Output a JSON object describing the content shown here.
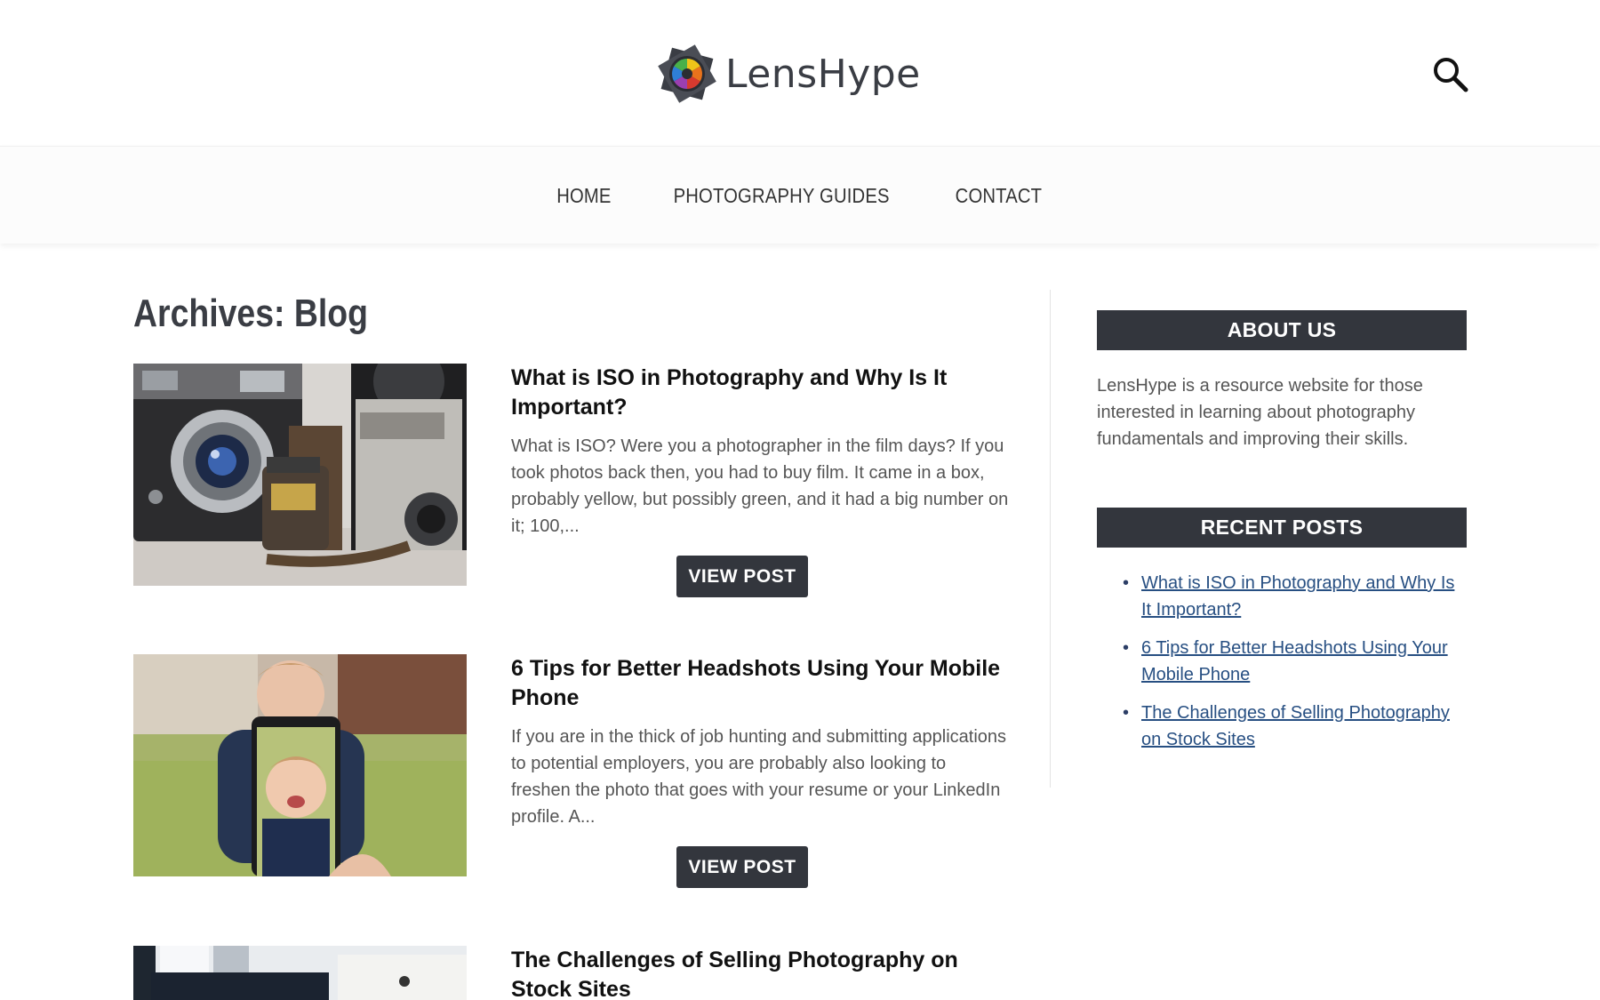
{
  "header": {
    "brand": "LensHype",
    "search_icon": "search-icon"
  },
  "nav": {
    "items": [
      {
        "label": "HOME"
      },
      {
        "label": "PHOTOGRAPHY GUIDES"
      },
      {
        "label": "CONTACT"
      }
    ]
  },
  "main": {
    "archive_title": "Archives: Blog",
    "posts": [
      {
        "title": "What is ISO in Photography and Why Is It Important?",
        "excerpt": "What is ISO? Were you a photographer in the film days? If you took photos back then, you had to buy film. It came in a box, probably yellow, but possibly green, and it had a big number on it; 100,...",
        "button": "VIEW POST"
      },
      {
        "title": "6 Tips for Better Headshots Using Your Mobile Phone",
        "excerpt": "If you are in the thick of job hunting and submitting applications to potential employers, you are probably also looking to freshen the photo that goes with your resume or your LinkedIn profile. A...",
        "button": "VIEW POST"
      },
      {
        "title": "The Challenges of Selling Photography on Stock Sites"
      }
    ]
  },
  "sidebar": {
    "about": {
      "title": "ABOUT US",
      "text": "LensHype is a resource website for those interested in learning about photography fundamentals and improving their skills."
    },
    "recent": {
      "title": "RECENT POSTS",
      "items": [
        {
          "label": "What is ISO in Photography and Why Is It Important?"
        },
        {
          "label": "6 Tips for Better Headshots Using Your Mobile Phone"
        },
        {
          "label": "The Challenges of Selling Photography on Stock Sites"
        }
      ]
    }
  },
  "colors": {
    "dark_button": "#33363d",
    "link": "#274f82"
  }
}
